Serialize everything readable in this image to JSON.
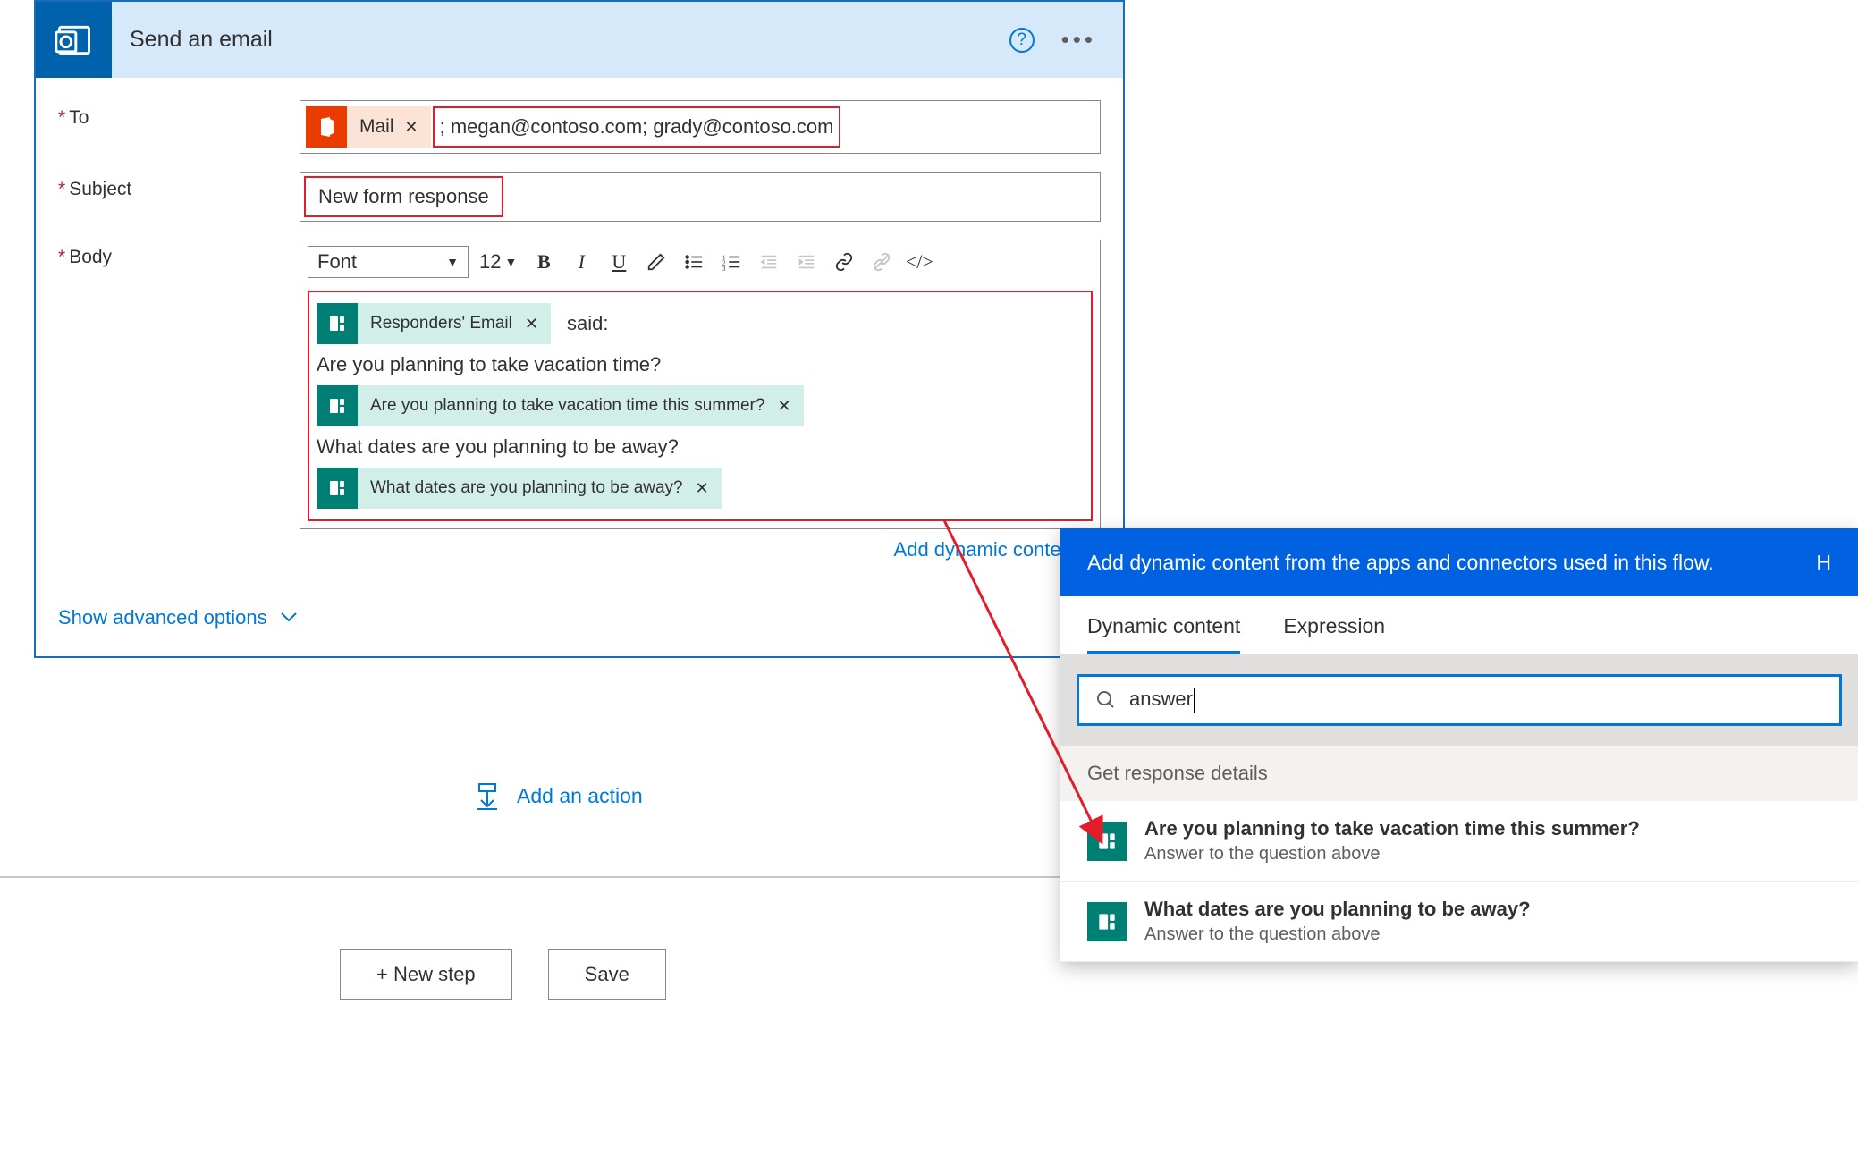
{
  "card": {
    "title": "Send an email",
    "to_label": "To",
    "subject_label": "Subject",
    "body_label": "Body",
    "advanced": "Show advanced options",
    "add_dynamic": "Add dynamic content"
  },
  "to": {
    "token_label": "Mail",
    "text": "; megan@contoso.com; grady@contoso.com"
  },
  "subject": {
    "value": "New form response"
  },
  "rte": {
    "font_label": "Font",
    "font_size": "12"
  },
  "body": {
    "token1": "Responders' Email",
    "trail1": "said:",
    "line1": "Are you planning to take vacation time?",
    "token2": "Are you planning to take vacation time this summer?",
    "line2": "What dates are you planning to be away?",
    "token3": "What dates are you planning to be away?"
  },
  "add_action": "Add an action",
  "buttons": {
    "new_step": "+ New step",
    "save": "Save"
  },
  "dyn": {
    "header": "Add dynamic content from the apps and connectors used in this flow.",
    "hide": "H",
    "tab1": "Dynamic content",
    "tab2": "Expression",
    "search_value": "answer",
    "section": "Get response details",
    "items": [
      {
        "title": "Are you planning to take vacation time this summer?",
        "sub": "Answer to the question above"
      },
      {
        "title": "What dates are you planning to be away?",
        "sub": "Answer to the question above"
      }
    ]
  }
}
